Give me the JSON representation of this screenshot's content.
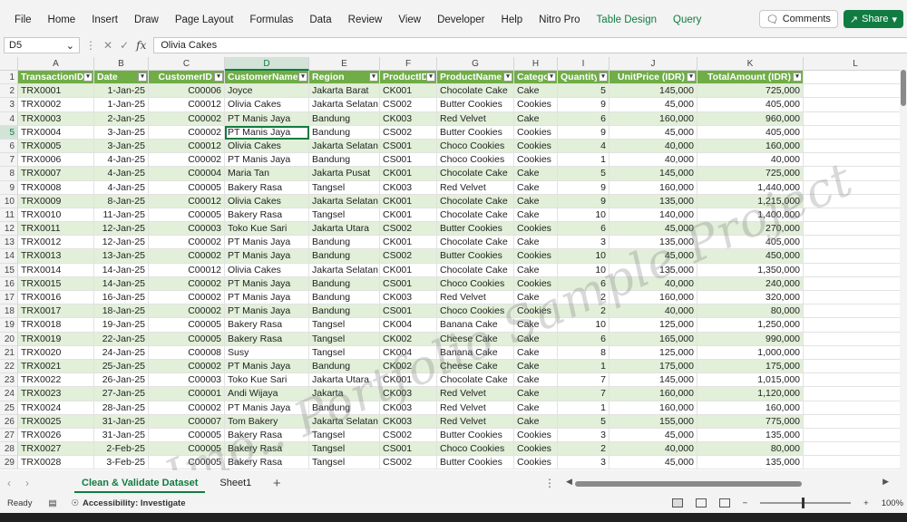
{
  "menu": [
    "File",
    "Home",
    "Insert",
    "Draw",
    "Page Layout",
    "Formulas",
    "Data",
    "Review",
    "View",
    "Developer",
    "Help",
    "Nitro Pro",
    "Table Design",
    "Query"
  ],
  "menu_accent": [
    "Table Design",
    "Query"
  ],
  "comments_label": "Comments",
  "share_label": "Share",
  "name_box": "D5",
  "fx_label": "fx",
  "formula_value": "Olivia Cakes",
  "column_letters": [
    "A",
    "B",
    "C",
    "D",
    "E",
    "F",
    "G",
    "H",
    "I",
    "J",
    "K",
    "L"
  ],
  "selected_column": "D",
  "table_headers": [
    "TransactionID",
    "Date",
    "CustomerID",
    "CustomerName",
    "Region",
    "ProductID",
    "ProductName",
    "Category",
    "Quantity",
    "UnitPrice (IDR)",
    "TotalAmount (IDR)"
  ],
  "rows": [
    [
      "TRX0001",
      "1-Jan-25",
      "C00006",
      "Joyce",
      "Jakarta Barat",
      "CK001",
      "Chocolate Cake",
      "Cake",
      "5",
      "145,000",
      "725,000"
    ],
    [
      "TRX0002",
      "1-Jan-25",
      "C00012",
      "Olivia Cakes",
      "Jakarta Selatan",
      "CS002",
      "Butter Cookies",
      "Cookies",
      "9",
      "45,000",
      "405,000"
    ],
    [
      "TRX0003",
      "2-Jan-25",
      "C00002",
      "PT Manis Jaya",
      "Bandung",
      "CK003",
      "Red Velvet",
      "Cake",
      "6",
      "160,000",
      "960,000"
    ],
    [
      "TRX0004",
      "3-Jan-25",
      "C00002",
      "PT Manis Jaya",
      "Bandung",
      "CS002",
      "Butter Cookies",
      "Cookies",
      "9",
      "45,000",
      "405,000"
    ],
    [
      "TRX0005",
      "3-Jan-25",
      "C00012",
      "Olivia Cakes",
      "Jakarta Selatan",
      "CS001",
      "Choco Cookies",
      "Cookies",
      "4",
      "40,000",
      "160,000"
    ],
    [
      "TRX0006",
      "4-Jan-25",
      "C00002",
      "PT Manis Jaya",
      "Bandung",
      "CS001",
      "Choco Cookies",
      "Cookies",
      "1",
      "40,000",
      "40,000"
    ],
    [
      "TRX0007",
      "4-Jan-25",
      "C00004",
      "Maria Tan",
      "Jakarta Pusat",
      "CK001",
      "Chocolate Cake",
      "Cake",
      "5",
      "145,000",
      "725,000"
    ],
    [
      "TRX0008",
      "4-Jan-25",
      "C00005",
      "Bakery Rasa",
      "Tangsel",
      "CK003",
      "Red Velvet",
      "Cake",
      "9",
      "160,000",
      "1,440,000"
    ],
    [
      "TRX0009",
      "8-Jan-25",
      "C00012",
      "Olivia Cakes",
      "Jakarta Selatan",
      "CK001",
      "Chocolate Cake",
      "Cake",
      "9",
      "135,000",
      "1,215,000"
    ],
    [
      "TRX0010",
      "11-Jan-25",
      "C00005",
      "Bakery Rasa",
      "Tangsel",
      "CK001",
      "Chocolate Cake",
      "Cake",
      "10",
      "140,000",
      "1,400,000"
    ],
    [
      "TRX0011",
      "12-Jan-25",
      "C00003",
      "Toko Kue Sari",
      "Jakarta Utara",
      "CS002",
      "Butter Cookies",
      "Cookies",
      "6",
      "45,000",
      "270,000"
    ],
    [
      "TRX0012",
      "12-Jan-25",
      "C00002",
      "PT Manis Jaya",
      "Bandung",
      "CK001",
      "Chocolate Cake",
      "Cake",
      "3",
      "135,000",
      "405,000"
    ],
    [
      "TRX0013",
      "13-Jan-25",
      "C00002",
      "PT Manis Jaya",
      "Bandung",
      "CS002",
      "Butter Cookies",
      "Cookies",
      "10",
      "45,000",
      "450,000"
    ],
    [
      "TRX0014",
      "14-Jan-25",
      "C00012",
      "Olivia Cakes",
      "Jakarta Selatan",
      "CK001",
      "Chocolate Cake",
      "Cake",
      "10",
      "135,000",
      "1,350,000"
    ],
    [
      "TRX0015",
      "14-Jan-25",
      "C00002",
      "PT Manis Jaya",
      "Bandung",
      "CS001",
      "Choco Cookies",
      "Cookies",
      "6",
      "40,000",
      "240,000"
    ],
    [
      "TRX0016",
      "16-Jan-25",
      "C00002",
      "PT Manis Jaya",
      "Bandung",
      "CK003",
      "Red Velvet",
      "Cake",
      "2",
      "160,000",
      "320,000"
    ],
    [
      "TRX0017",
      "18-Jan-25",
      "C00002",
      "PT Manis Jaya",
      "Bandung",
      "CS001",
      "Choco Cookies",
      "Cookies",
      "2",
      "40,000",
      "80,000"
    ],
    [
      "TRX0018",
      "19-Jan-25",
      "C00005",
      "Bakery Rasa",
      "Tangsel",
      "CK004",
      "Banana Cake",
      "Cake",
      "10",
      "125,000",
      "1,250,000"
    ],
    [
      "TRX0019",
      "22-Jan-25",
      "C00005",
      "Bakery Rasa",
      "Tangsel",
      "CK002",
      "Cheese Cake",
      "Cake",
      "6",
      "165,000",
      "990,000"
    ],
    [
      "TRX0020",
      "24-Jan-25",
      "C00008",
      "Susy",
      "Tangsel",
      "CK004",
      "Banana Cake",
      "Cake",
      "8",
      "125,000",
      "1,000,000"
    ],
    [
      "TRX0021",
      "25-Jan-25",
      "C00002",
      "PT Manis Jaya",
      "Bandung",
      "CK002",
      "Cheese Cake",
      "Cake",
      "1",
      "175,000",
      "175,000"
    ],
    [
      "TRX0022",
      "26-Jan-25",
      "C00003",
      "Toko Kue Sari",
      "Jakarta Utara",
      "CK001",
      "Chocolate Cake",
      "Cake",
      "7",
      "145,000",
      "1,015,000"
    ],
    [
      "TRX0023",
      "27-Jan-25",
      "C00001",
      "Andi Wijaya",
      "Jakarta",
      "CK003",
      "Red Velvet",
      "Cake",
      "7",
      "160,000",
      "1,120,000"
    ],
    [
      "TRX0024",
      "28-Jan-25",
      "C00002",
      "PT Manis Jaya",
      "Bandung",
      "CK003",
      "Red Velvet",
      "Cake",
      "1",
      "160,000",
      "160,000"
    ],
    [
      "TRX0025",
      "31-Jan-25",
      "C00007",
      "Tom Bakery",
      "Jakarta Selatan",
      "CK003",
      "Red Velvet",
      "Cake",
      "5",
      "155,000",
      "775,000"
    ],
    [
      "TRX0026",
      "31-Jan-25",
      "C00005",
      "Bakery Rasa",
      "Tangsel",
      "CS002",
      "Butter Cookies",
      "Cookies",
      "3",
      "45,000",
      "135,000"
    ],
    [
      "TRX0027",
      "2-Feb-25",
      "C00005",
      "Bakery Rasa",
      "Tangsel",
      "CS001",
      "Choco Cookies",
      "Cookies",
      "2",
      "40,000",
      "80,000"
    ],
    [
      "TRX0028",
      "3-Feb-25",
      "C00005",
      "Bakery Rasa",
      "Tangsel",
      "CS002",
      "Butter Cookies",
      "Cookies",
      "3",
      "45,000",
      "135,000"
    ]
  ],
  "watermark": "Imo.. Portfolio Sample Project",
  "sheet_tabs": [
    "Clean & Validate Dataset",
    "Sheet1"
  ],
  "active_sheet": "Clean & Validate Dataset",
  "status_ready": "Ready",
  "accessibility": "Accessibility: Investigate",
  "zoom": "100%",
  "colors": {
    "accent": "#107c41",
    "table_header": "#70ad47",
    "band": "#e2efd9"
  }
}
